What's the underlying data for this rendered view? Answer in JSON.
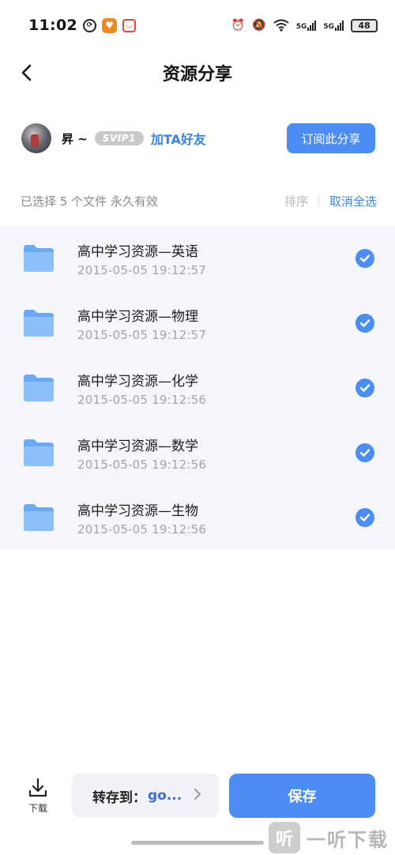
{
  "status_bar": {
    "time": "11:02",
    "net_5g_1": "5G",
    "net_5g_2": "5G",
    "battery": "48"
  },
  "header": {
    "title": "资源分享"
  },
  "user": {
    "name": "昇 ~",
    "vip_badge": "SVIP1",
    "add_friend": "加TA好友",
    "subscribe": "订阅此分享"
  },
  "selection": {
    "info": "已选择 5 个文件  永久有效",
    "sort": "排序",
    "deselect_all": "取消全选"
  },
  "files": [
    {
      "name": "高中学习资源—英语",
      "date": "2015-05-05  19:12:57",
      "checked": true
    },
    {
      "name": "高中学习资源—物理",
      "date": "2015-05-05  19:12:57",
      "checked": true
    },
    {
      "name": "高中学习资源—化学",
      "date": "2015-05-05  19:12:56",
      "checked": true
    },
    {
      "name": "高中学习资源—数学",
      "date": "2015-05-05  19:12:56",
      "checked": true
    },
    {
      "name": "高中学习资源—生物",
      "date": "2015-05-05  19:12:56",
      "checked": true
    }
  ],
  "bottom": {
    "download": "下载",
    "save_to_label": "转存到：",
    "save_to_value": "go...",
    "save": "保存"
  },
  "watermark": {
    "logo": "听",
    "text": "一听下载"
  },
  "colors": {
    "accent": "#4b8df2",
    "link": "#3b82e6",
    "list_bg": "#f4f6fa"
  }
}
